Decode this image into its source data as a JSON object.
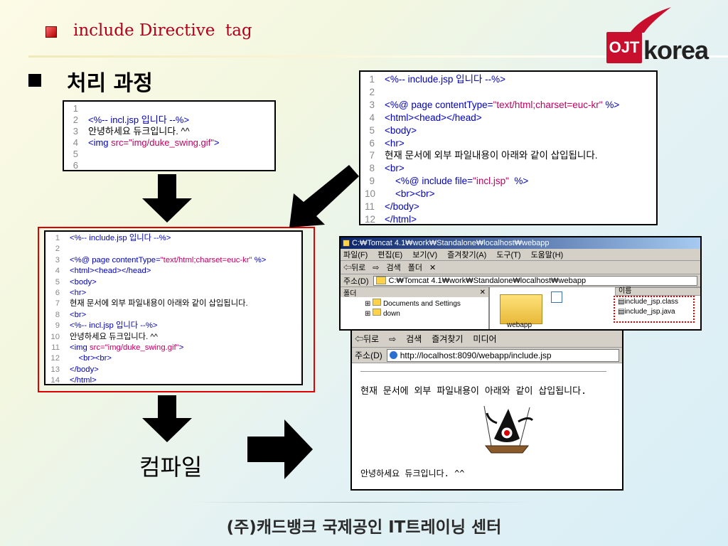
{
  "header": {
    "title": "include Directive  tag",
    "logo_left": "OJT",
    "logo_right": "korea"
  },
  "section": {
    "title": "처리 과정"
  },
  "incl_jsp_code": [
    {
      "n": "1",
      "parts": []
    },
    {
      "n": "2",
      "parts": [
        {
          "c": "blue",
          "t": "<%-- incl.jsp 입니다 --%>"
        }
      ]
    },
    {
      "n": "3",
      "parts": [
        {
          "c": "",
          "t": "안녕하세요 듀크입니다. ^^"
        }
      ]
    },
    {
      "n": "4",
      "parts": [
        {
          "c": "blue",
          "t": "<img "
        },
        {
          "c": "mag",
          "t": "src=\"img/duke_swing.gif\""
        },
        {
          "c": "blue",
          "t": ">"
        }
      ]
    },
    {
      "n": "5",
      "parts": []
    },
    {
      "n": "6",
      "parts": []
    }
  ],
  "include_jsp_code": [
    {
      "n": "1",
      "parts": [
        {
          "c": "blue",
          "t": "<%-- include.jsp 입니다 --%>"
        }
      ]
    },
    {
      "n": "2",
      "parts": []
    },
    {
      "n": "3",
      "parts": [
        {
          "c": "blue",
          "t": "<%@ page contentType="
        },
        {
          "c": "mag",
          "t": "\"text/html;charset=euc-kr\""
        },
        {
          "c": "blue",
          "t": " %>"
        }
      ]
    },
    {
      "n": "4",
      "parts": [
        {
          "c": "blue",
          "t": "<html><head></head>"
        }
      ]
    },
    {
      "n": "5",
      "parts": [
        {
          "c": "blue",
          "t": "<body>"
        }
      ]
    },
    {
      "n": "6",
      "parts": [
        {
          "c": "blue",
          "t": "<hr>"
        }
      ]
    },
    {
      "n": "7",
      "parts": [
        {
          "c": "",
          "t": "현재 문서에 외부 파일내용이 아래와 같이 삽입됩니다."
        }
      ]
    },
    {
      "n": "8",
      "parts": [
        {
          "c": "blue",
          "t": "<br>"
        }
      ]
    },
    {
      "n": "9",
      "parts": [
        {
          "c": "blue",
          "t": "    <%@ include file="
        },
        {
          "c": "mag",
          "t": "\"incl.jsp\""
        },
        {
          "c": "blue",
          "t": "  %>"
        }
      ]
    },
    {
      "n": "10",
      "parts": [
        {
          "c": "blue",
          "t": "    <br><br>"
        }
      ]
    },
    {
      "n": "11",
      "parts": [
        {
          "c": "blue",
          "t": "</body>"
        }
      ]
    },
    {
      "n": "12",
      "parts": [
        {
          "c": "blue",
          "t": "</html>"
        }
      ]
    }
  ],
  "merged_code": [
    {
      "n": "1",
      "parts": [
        {
          "c": "blue",
          "t": "<%-- include.jsp 입니다 --%>"
        }
      ]
    },
    {
      "n": "2",
      "parts": []
    },
    {
      "n": "3",
      "parts": [
        {
          "c": "blue",
          "t": "<%@ page contentType="
        },
        {
          "c": "mag",
          "t": "\"text/html;charset=euc-kr\""
        },
        {
          "c": "blue",
          "t": " %>"
        }
      ]
    },
    {
      "n": "4",
      "parts": [
        {
          "c": "blue",
          "t": "<html><head></head>"
        }
      ]
    },
    {
      "n": "5",
      "parts": [
        {
          "c": "blue",
          "t": "<body>"
        }
      ]
    },
    {
      "n": "6",
      "parts": [
        {
          "c": "blue",
          "t": "<hr>"
        }
      ]
    },
    {
      "n": "7",
      "parts": [
        {
          "c": "",
          "t": "현재 문서에 외부 파일내용이 아래와 같이 삽입됩니다."
        }
      ]
    },
    {
      "n": "8",
      "parts": [
        {
          "c": "blue",
          "t": "<br>"
        }
      ]
    },
    {
      "n": "9",
      "parts": [
        {
          "c": "blue",
          "t": "<%-- incl.jsp 입니다 --%>"
        }
      ]
    },
    {
      "n": "10",
      "parts": [
        {
          "c": "",
          "t": "안녕하세요 듀크입니다. ^^"
        }
      ]
    },
    {
      "n": "11",
      "parts": [
        {
          "c": "blue",
          "t": "<img "
        },
        {
          "c": "mag",
          "t": "src=\"img/duke_swing.gif\""
        },
        {
          "c": "blue",
          "t": ">"
        }
      ]
    },
    {
      "n": "12",
      "parts": [
        {
          "c": "blue",
          "t": "    <br><br>"
        }
      ]
    },
    {
      "n": "13",
      "parts": [
        {
          "c": "blue",
          "t": "</body>"
        }
      ]
    },
    {
      "n": "14",
      "parts": [
        {
          "c": "blue",
          "t": "</html>"
        }
      ]
    }
  ],
  "explorer": {
    "title": "C:₩Tomcat 4.1₩work₩Standalone₩localhost₩webapp",
    "menu": [
      "파일(F)",
      "편집(E)",
      "보기(V)",
      "즐겨찾기(A)",
      "도구(T)",
      "도움말(H)"
    ],
    "toolbar": [
      "⇦뒤로",
      "⇨",
      "검색",
      "폴더",
      "✕"
    ],
    "address_label": "주소(D)",
    "address_value": "C:₩Tomcat 4.1₩work₩Standalone₩localhost₩webapp",
    "folder_pane_label": "폴더",
    "tree": [
      "Documents and Settings",
      "down"
    ],
    "name_column": "이름",
    "folder_caption": "webapp",
    "files": [
      "include_jsp.class",
      "include_jsp.java"
    ]
  },
  "browser": {
    "toolbar": [
      "⇦뒤로",
      "⇨",
      "검색",
      "즐겨찾기",
      "미디어"
    ],
    "address_label": "주소(D)",
    "address_value": "http://localhost:8090/webapp/include.jsp",
    "line1": "현재 문서에 외부 파일내용이 아래와 같이 삽입됩니다.",
    "line2": "안녕하세요 듀크입니다. ^^"
  },
  "compile_label": "컴파일",
  "footer": "(주)캐드뱅크 국제공인 IT트레이닝 센터",
  "colors": {
    "title": "#b0001c",
    "tag_blue": "#0000c0",
    "attr_magenta": "#c00060",
    "highlight_red": "#e00000"
  }
}
